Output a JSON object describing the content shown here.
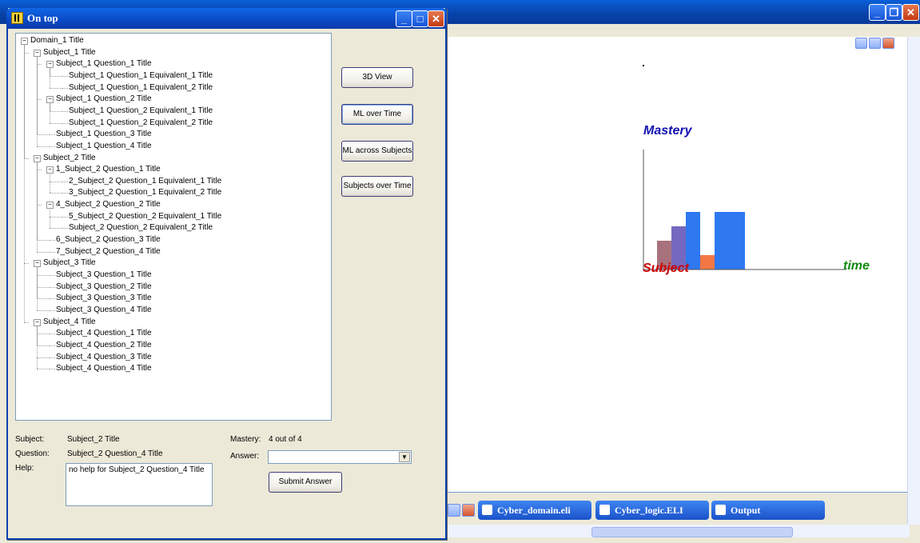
{
  "main_window": {
    "title": ""
  },
  "ontop_window": {
    "title": "On top"
  },
  "tree": [
    {
      "label": "Domain_1 Title",
      "level": 0,
      "toggle": "-"
    },
    {
      "label": "Subject_1 Title",
      "level": 1,
      "toggle": "-"
    },
    {
      "label": "Subject_1 Question_1 Title",
      "level": 2,
      "toggle": "-"
    },
    {
      "label": "Subject_1 Question_1 Equivalent_1 Title",
      "level": 3,
      "toggle": ""
    },
    {
      "label": "Subject_1 Question_1 Equivalent_2 Title",
      "level": 3,
      "toggle": ""
    },
    {
      "label": "Subject_1 Question_2 Title",
      "level": 2,
      "toggle": "-"
    },
    {
      "label": "Subject_1 Question_2 Equivalent_1 Title",
      "level": 3,
      "toggle": ""
    },
    {
      "label": "Subject_1 Question_2 Equivalent_2 Title",
      "level": 3,
      "toggle": ""
    },
    {
      "label": "Subject_1 Question_3 Title",
      "level": 2,
      "toggle": ""
    },
    {
      "label": "Subject_1 Question_4 Title",
      "level": 2,
      "toggle": ""
    },
    {
      "label": "Subject_2 Title",
      "level": 1,
      "toggle": "-"
    },
    {
      "label": "1_Subject_2 Question_1 Title",
      "level": 2,
      "toggle": "-"
    },
    {
      "label": "2_Subject_2 Question_1 Equivalent_1 Title",
      "level": 3,
      "toggle": ""
    },
    {
      "label": "3_Subject_2 Question_1 Equivalent_2 Title",
      "level": 3,
      "toggle": ""
    },
    {
      "label": "4_Subject_2 Question_2 Title",
      "level": 2,
      "toggle": "-"
    },
    {
      "label": "5_Subject_2 Question_2 Equivalent_1 Title",
      "level": 3,
      "toggle": ""
    },
    {
      "label": "Subject_2 Question_2 Equivalent_2 Title",
      "level": 3,
      "toggle": ""
    },
    {
      "label": "6_Subject_2 Question_3 Title",
      "level": 2,
      "toggle": ""
    },
    {
      "label": "7_Subject_2 Question_4 Title",
      "level": 2,
      "toggle": ""
    },
    {
      "label": "Subject_3 Title",
      "level": 1,
      "toggle": "-"
    },
    {
      "label": "Subject_3 Question_1 Title",
      "level": 2,
      "toggle": ""
    },
    {
      "label": "Subject_3 Question_2 Title",
      "level": 2,
      "toggle": ""
    },
    {
      "label": "Subject_3 Question_3 Title",
      "level": 2,
      "toggle": ""
    },
    {
      "label": "Subject_3 Question_4 Title",
      "level": 2,
      "toggle": ""
    },
    {
      "label": "Subject_4 Title",
      "level": 1,
      "toggle": "-"
    },
    {
      "label": "Subject_4 Question_1 Title",
      "level": 2,
      "toggle": ""
    },
    {
      "label": "Subject_4 Question_2 Title",
      "level": 2,
      "toggle": ""
    },
    {
      "label": "Subject_4 Question_3 Title",
      "level": 2,
      "toggle": ""
    },
    {
      "label": "Subject_4 Question_4 Title",
      "level": 2,
      "toggle": ""
    }
  ],
  "buttons": {
    "view3d": "3D View",
    "ml_over_time": "ML over Time",
    "ml_across_subjects": "ML across Subjects",
    "subjects_over_time": "Subjects over Time",
    "submit": "Submit Answer"
  },
  "details": {
    "subject_label": "Subject:",
    "subject_value": "Subject_2 Title",
    "question_label": "Question:",
    "question_value": "Subject_2 Question_4 Title",
    "help_label": "Help:",
    "help_value": "no help for Subject_2 Question_4 Title",
    "mastery_label": "Mastery:",
    "mastery_value": "4 out of 4",
    "answer_label": "Answer:",
    "answer_value": ""
  },
  "taskbar": [
    {
      "label": "Cyber_domain.eli"
    },
    {
      "label": "Cyber_logic.ELI"
    },
    {
      "label": "Output"
    }
  ],
  "chart_data": {
    "type": "bar",
    "ylabel": "Mastery",
    "xlabel": "time",
    "origin_label": "Subject",
    "series": [
      {
        "values": [
          2,
          3,
          4
        ],
        "colors": [
          "#a8727d",
          "#7468c0",
          "#2e78f0"
        ]
      },
      {
        "values": [
          1,
          4
        ],
        "colors": [
          "#f27744",
          "#2e78f0"
        ]
      }
    ],
    "ylim": [
      0,
      8
    ]
  },
  "colors": {
    "accent": "#0a48c4",
    "ylabel": "#1010b0",
    "xlabel": "#138a13",
    "origin": "#cc0000"
  }
}
